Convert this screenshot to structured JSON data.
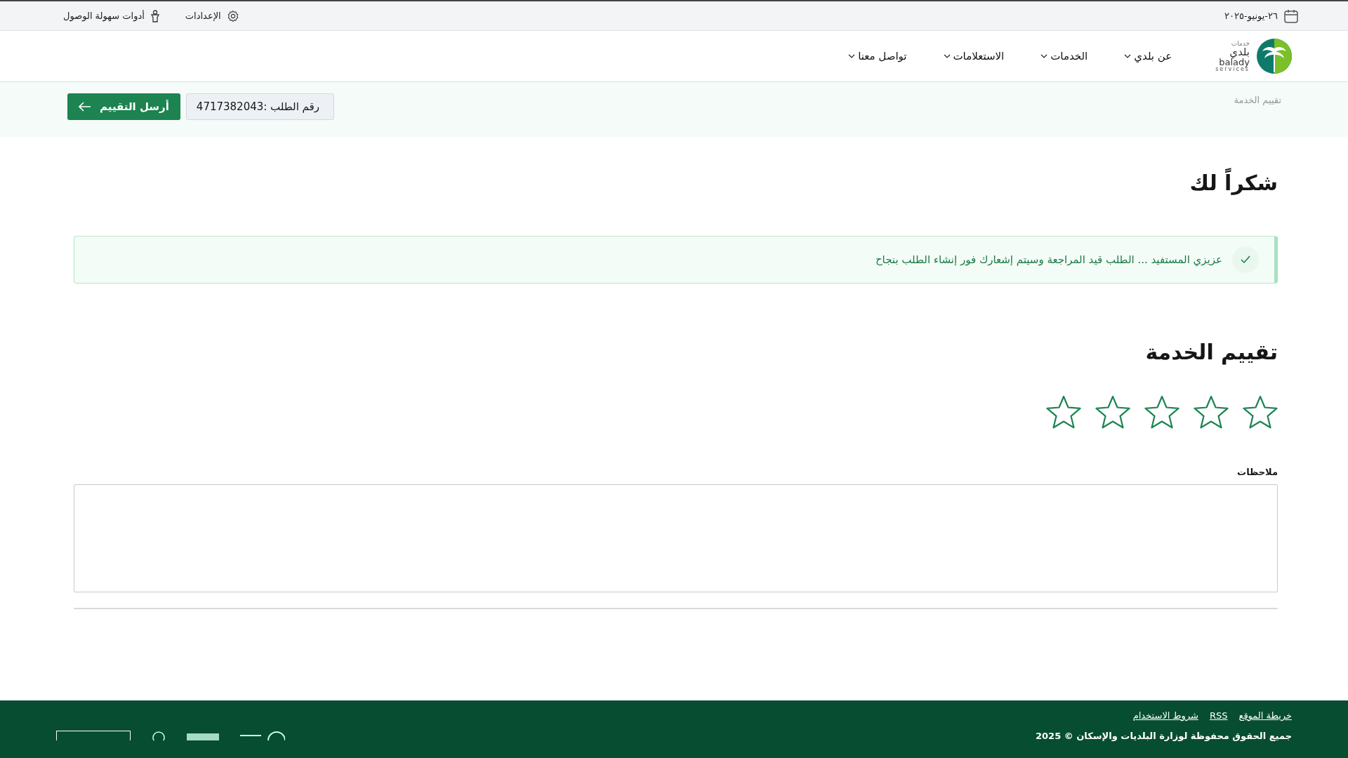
{
  "top_bar": {
    "date": "٢٦-يونيو-٢٠٢٥",
    "settings": "الإعدادات",
    "accessibility": "أدوات سهولة الوصول"
  },
  "nav": {
    "logo": {
      "arabic_top": "خدمات",
      "arabic_main": "بلدي",
      "latin_main": "balady",
      "latin_sub": "services"
    },
    "items": [
      {
        "label": "عن بلدي",
        "has_dropdown": true
      },
      {
        "label": "الخدمات",
        "has_dropdown": true
      },
      {
        "label": "الاستعلامات",
        "has_dropdown": true
      },
      {
        "label": "تواصل معنا",
        "has_dropdown": true
      }
    ]
  },
  "subheader": {
    "breadcrumb": "تقييم الخدمة",
    "request_number": "رقم الطلب :4717382043",
    "send_button": "أرسل التقييم"
  },
  "content": {
    "title": "شكراً لك",
    "alert": "عزيزي المستفيد ... الطلب قيد المراجعة وسيتم إشعارك فور إنشاء الطلب بنجاح",
    "rating_title": "تقييم الخدمة",
    "rating": {
      "stars": 0
    },
    "notes_label": "ملاحظات"
  },
  "footer": {
    "links": [
      "خريطة الموقع",
      "RSS",
      "شروط الاستخدام"
    ],
    "copyright": "جميع الحقوق محفوظة لوزارة البلديات والإسكان © 2025"
  }
}
